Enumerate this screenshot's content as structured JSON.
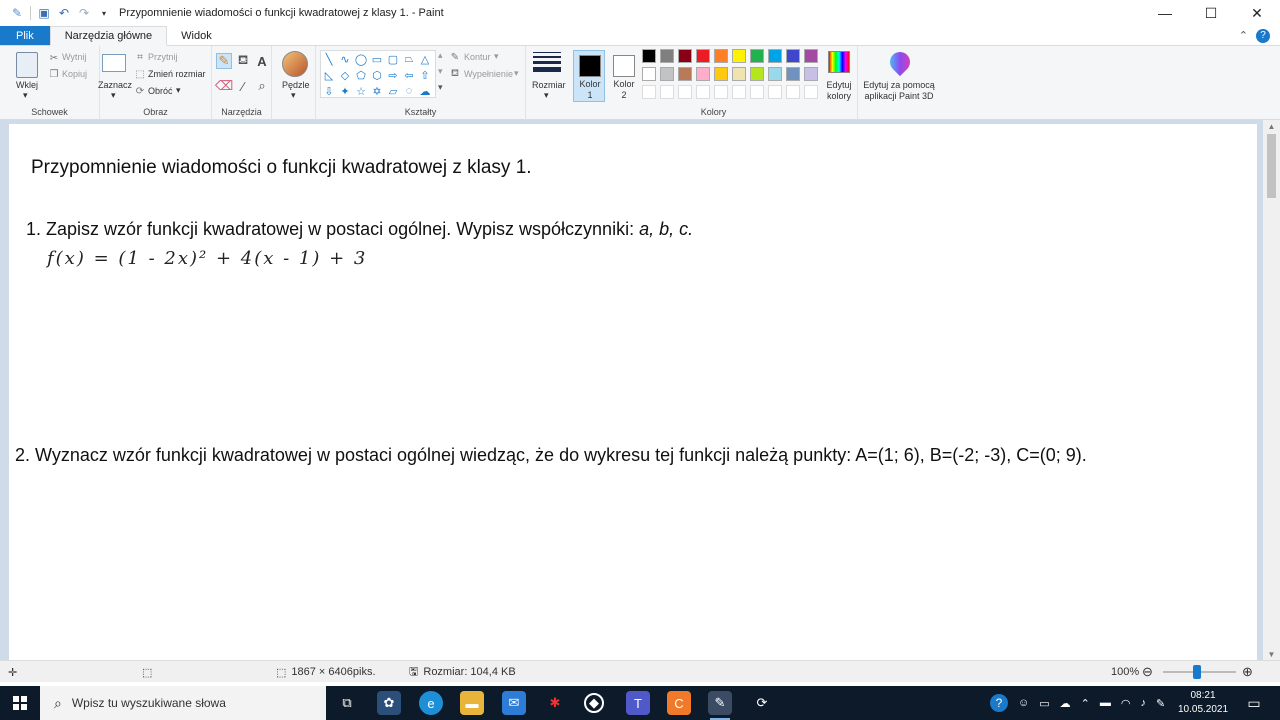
{
  "window": {
    "title": "Przypomnienie wiadomości o funkcji kwadratowej z klasy 1. - Paint",
    "minimize_icon": "minimize-icon",
    "maximize_icon": "maximize-icon",
    "close_icon": "close-icon"
  },
  "tabs": {
    "file": "Plik",
    "home": "Narzędzia główne",
    "view": "Widok"
  },
  "ribbon": {
    "clipboard": {
      "label": "Schowek",
      "paste": "Wklej",
      "cut": "Wytnij",
      "copy": "Kopiuj"
    },
    "image": {
      "label": "Obraz",
      "select": "Zaznacz",
      "crop": "Przytnij",
      "resize": "Zmień rozmiar",
      "rotate": "Obróć"
    },
    "tools": {
      "label": "Narzędzia"
    },
    "brushes": {
      "label": "Pędzle"
    },
    "shapes": {
      "label": "Kształty",
      "outline": "Kontur",
      "fill": "Wypełnienie"
    },
    "size": {
      "label": "Rozmiar"
    },
    "colors": {
      "label": "Kolory",
      "color1": "Kolor 1",
      "color2": "Kolor 2",
      "edit": "Edytuj kolory",
      "paint3d": "Edytuj za pomocą aplikacji Paint 3D",
      "color1_value": "#000000",
      "color2_value": "#ffffff",
      "palette": [
        "#000000",
        "#7f7f7f",
        "#880015",
        "#ed1c24",
        "#ff7f27",
        "#fff200",
        "#22b14c",
        "#00a2e8",
        "#3f48cc",
        "#a349a4",
        "#ffffff",
        "#c3c3c3",
        "#b97a57",
        "#ffaec9",
        "#ffc90e",
        "#efe4b0",
        "#b5e61d",
        "#99d9ea",
        "#7092be",
        "#c8bfe7",
        "#ffffff",
        "#ffffff",
        "#ffffff",
        "#ffffff",
        "#ffffff",
        "#ffffff",
        "#ffffff",
        "#ffffff",
        "#ffffff",
        "#ffffff"
      ]
    }
  },
  "document": {
    "heading": "Przypomnienie wiadomości o funkcji kwadratowej z klasy 1.",
    "task1_text": "1. Zapisz wzór funkcji kwadratowej w postaci ogólnej. Wypisz współczynniki: ",
    "task1_italic": "a, b, c.",
    "handwritten": "f(x) = (1 - 2x)² + 4(x - 1) + 3",
    "task2_text": "2. Wyznacz wzór funkcji kwadratowej w postaci ogólnej wiedząc, że do wykresu tej funkcji należą punkty: A=(1; 6), B=(-2; -3), C=(0; 9)."
  },
  "statusbar": {
    "dimensions": "1867 × 6406piks.",
    "size": "Rozmiar: 104,4 KB",
    "zoom": "100%"
  },
  "taskbar": {
    "search_placeholder": "Wpisz tu wyszukiwane słowa",
    "time": "08:21",
    "date": "10.05.2021"
  }
}
